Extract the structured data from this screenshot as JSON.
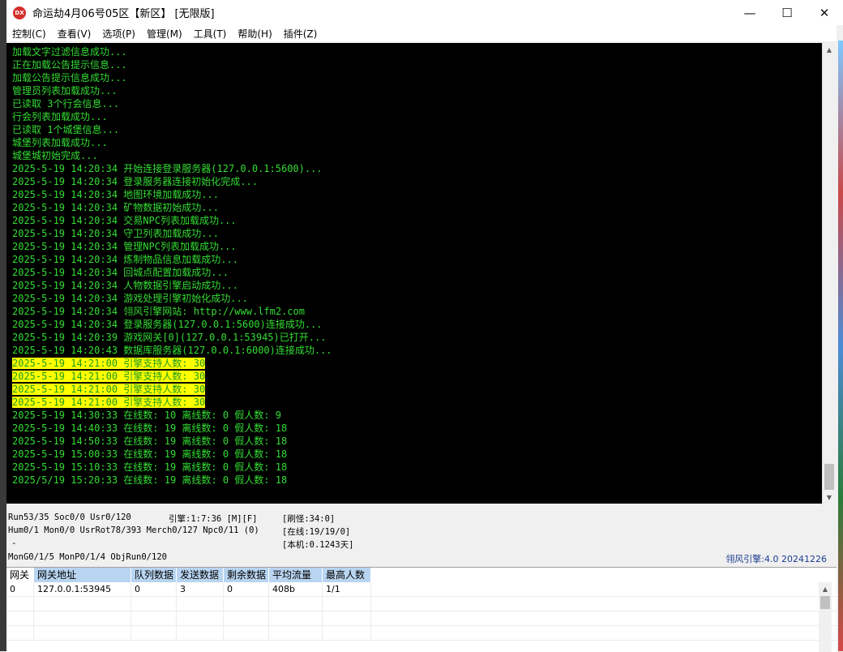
{
  "window": {
    "title": "命运劫4月06号05区【新区】 [无限版]",
    "icon_text": "DX",
    "controls": [
      "—",
      "☐",
      "✕"
    ]
  },
  "menu": [
    "控制(C)",
    "查看(V)",
    "选项(P)",
    "管理(M)",
    "工具(T)",
    "帮助(H)",
    "插件(Z)"
  ],
  "log": [
    {
      "text": "加载文字过滤信息成功...",
      "hl": false
    },
    {
      "text": "正在加载公告提示信息...",
      "hl": false
    },
    {
      "text": "加载公告提示信息成功...",
      "hl": false
    },
    {
      "text": "管理员列表加载成功...",
      "hl": false
    },
    {
      "text": "已读取 3个行会信息...",
      "hl": false
    },
    {
      "text": "行会列表加载成功...",
      "hl": false
    },
    {
      "text": "已读取 1个城堡信息...",
      "hl": false
    },
    {
      "text": "城堡列表加载成功...",
      "hl": false
    },
    {
      "text": "城堡城初始完成...",
      "hl": false
    },
    {
      "text": "2025-5-19 14:20:34 开始连接登录服务器(127.0.0.1:5600)...",
      "hl": false
    },
    {
      "text": "2025-5-19 14:20:34 登录服务器连接初始化完成...",
      "hl": false
    },
    {
      "text": "2025-5-19 14:20:34 地图环境加载成功...",
      "hl": false
    },
    {
      "text": "2025-5-19 14:20:34 矿物数据初始成功...",
      "hl": false
    },
    {
      "text": "2025-5-19 14:20:34 交易NPC列表加载成功...",
      "hl": false
    },
    {
      "text": "2025-5-19 14:20:34 守卫列表加载成功...",
      "hl": false
    },
    {
      "text": "2025-5-19 14:20:34 管理NPC列表加载成功...",
      "hl": false
    },
    {
      "text": "2025-5-19 14:20:34 炼制物品信息加载成功...",
      "hl": false
    },
    {
      "text": "2025-5-19 14:20:34 回城点配置加载成功...",
      "hl": false
    },
    {
      "text": "2025-5-19 14:20:34 人物数据引擎启动成功...",
      "hl": false
    },
    {
      "text": "2025-5-19 14:20:34 游戏处理引擎初始化成功...",
      "hl": false
    },
    {
      "text": "2025-5-19 14:20:34 翎风引擎网站: http://www.lfm2.com",
      "hl": false
    },
    {
      "text": "2025-5-19 14:20:34 登录服务器(127.0.0.1:5600)连接成功...",
      "hl": false
    },
    {
      "text": "2025-5-19 14:20:39 游戏网关[0](127.0.0.1:53945)已打开...",
      "hl": false
    },
    {
      "text": "2025-5-19 14:20:43 数据库服务器(127.0.0.1:6000)连接成功...",
      "hl": false
    },
    {
      "text": "2025-5-19 14:21:00 引擎支持人数: 30",
      "hl": true
    },
    {
      "text": "2025-5-19 14:21:00 引擎支持人数: 30",
      "hl": true
    },
    {
      "text": "2025-5-19 14:21:00 引擎支持人数: 30",
      "hl": true
    },
    {
      "text": "2025-5-19 14:21:00 引擎支持人数: 30",
      "hl": true
    },
    {
      "text": "2025-5-19 14:30:33 在线数: 10 离线数: 0 假人数: 9",
      "hl": false
    },
    {
      "text": "2025-5-19 14:40:33 在线数: 19 离线数: 0 假人数: 18",
      "hl": false
    },
    {
      "text": "2025-5-19 14:50:33 在线数: 19 离线数: 0 假人数: 18",
      "hl": false
    },
    {
      "text": "2025-5-19 15:00:33 在线数: 19 离线数: 0 假人数: 18",
      "hl": false
    },
    {
      "text": "2025-5-19 15:10:33 在线数: 19 离线数: 0 假人数: 18",
      "hl": false
    },
    {
      "text": "2025/5/19 15:20:33 在线数: 19 离线数: 0 假人数: 18",
      "hl": false
    }
  ],
  "status": {
    "line1": "Run53/35 Soc0/0 Usr0/120",
    "line1_engine": "引擎:1:7:36 [M][F]",
    "line1_right": "[刷怪:34:0]",
    "line2": "Hum0/1 Mon0/0 UsrRot78/393 Merch0/127 Npc0/11 (0)",
    "line2_right": "[在线:19/19/0]",
    "line3": "-",
    "line3_right": "[本机:0.1243天]",
    "line4": "MonG0/1/5 MonP0/1/4 ObjRun0/120",
    "engine_version": "翎风引擎:4.0 20241226"
  },
  "grid": {
    "headers": [
      "网关",
      "网关地址",
      "队列数据",
      "发送数据",
      "剩余数据",
      "平均流量",
      "最高人数"
    ],
    "rows": [
      [
        "0",
        "127.0.0.1:53945",
        "0",
        "3",
        "0",
        "408b",
        "1/1"
      ]
    ]
  }
}
